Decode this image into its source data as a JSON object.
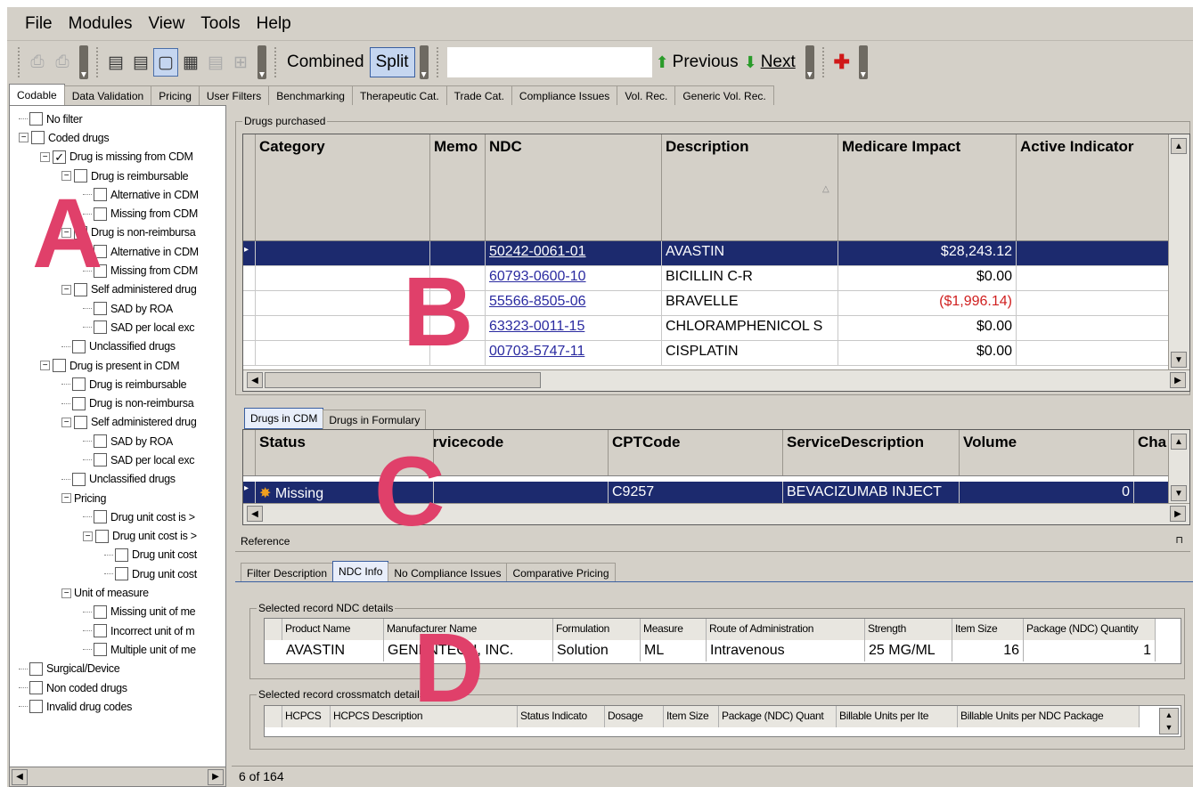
{
  "menu": {
    "file": "File",
    "modules": "Modules",
    "view": "View",
    "tools": "Tools",
    "help": "Help"
  },
  "toolbar": {
    "combined": "Combined",
    "split": "Split",
    "search_value": "",
    "previous": "Previous",
    "next": "Next"
  },
  "tabs": [
    "Codable",
    "Data Validation",
    "Pricing",
    "User Filters",
    "Benchmarking",
    "Therapeutic Cat.",
    "Trade Cat.",
    "Compliance Issues",
    "Vol. Rec.",
    "Generic Vol. Rec."
  ],
  "tree": [
    {
      "label": "No filter",
      "indent": 0,
      "exp": "",
      "checked": false
    },
    {
      "label": "Coded drugs",
      "indent": 0,
      "exp": "-",
      "checked": false
    },
    {
      "label": "Drug is missing from CDM",
      "indent": 1,
      "exp": "-",
      "checked": true
    },
    {
      "label": "Drug is reimbursable",
      "indent": 2,
      "exp": "-",
      "checked": false
    },
    {
      "label": "Alternative in CDM",
      "indent": 3,
      "exp": "",
      "checked": false
    },
    {
      "label": "Missing from CDM",
      "indent": 3,
      "exp": "",
      "checked": false
    },
    {
      "label": "Drug is non-reimbursa",
      "indent": 2,
      "exp": "-",
      "checked": false
    },
    {
      "label": "Alternative in CDM",
      "indent": 3,
      "exp": "",
      "checked": false
    },
    {
      "label": "Missing from CDM",
      "indent": 3,
      "exp": "",
      "checked": false
    },
    {
      "label": "Self administered drug",
      "indent": 2,
      "exp": "-",
      "checked": false
    },
    {
      "label": "SAD by ROA",
      "indent": 3,
      "exp": "",
      "checked": false
    },
    {
      "label": "SAD per local exc",
      "indent": 3,
      "exp": "",
      "checked": false
    },
    {
      "label": "Unclassified drugs",
      "indent": 2,
      "exp": "",
      "checked": false
    },
    {
      "label": "Drug is present in CDM",
      "indent": 1,
      "exp": "-",
      "checked": false
    },
    {
      "label": "Drug is reimbursable",
      "indent": 2,
      "exp": "",
      "checked": false
    },
    {
      "label": "Drug is non-reimbursa",
      "indent": 2,
      "exp": "",
      "checked": false
    },
    {
      "label": "Self administered drug",
      "indent": 2,
      "exp": "-",
      "checked": false
    },
    {
      "label": "SAD by ROA",
      "indent": 3,
      "exp": "",
      "checked": false
    },
    {
      "label": "SAD per local exc",
      "indent": 3,
      "exp": "",
      "checked": false
    },
    {
      "label": "Unclassified drugs",
      "indent": 2,
      "exp": "",
      "checked": false
    },
    {
      "label": "Pricing",
      "indent": 2,
      "exp": "-",
      "checked": null
    },
    {
      "label": "Drug unit cost is >",
      "indent": 3,
      "exp": "",
      "checked": false
    },
    {
      "label": "Drug unit cost is >",
      "indent": 3,
      "exp": "-",
      "checked": false
    },
    {
      "label": "Drug unit cost",
      "indent": 4,
      "exp": "",
      "checked": false
    },
    {
      "label": "Drug unit cost",
      "indent": 4,
      "exp": "",
      "checked": false
    },
    {
      "label": "Unit of measure",
      "indent": 2,
      "exp": "-",
      "checked": null
    },
    {
      "label": "Missing unit of me",
      "indent": 3,
      "exp": "",
      "checked": false
    },
    {
      "label": "Incorrect unit of m",
      "indent": 3,
      "exp": "",
      "checked": false
    },
    {
      "label": "Multiple unit of me",
      "indent": 3,
      "exp": "",
      "checked": false
    },
    {
      "label": "Surgical/Device",
      "indent": 0,
      "exp": "",
      "checked": false
    },
    {
      "label": "Non coded drugs",
      "indent": 0,
      "exp": "",
      "checked": false
    },
    {
      "label": "Invalid drug codes",
      "indent": 0,
      "exp": "",
      "checked": false
    }
  ],
  "drugs_purchased": {
    "label": "Drugs purchased",
    "columns": [
      "Category",
      "Memo",
      "NDC",
      "Description",
      "Medicare Impact",
      "Active Indicator"
    ],
    "rows": [
      {
        "ndc": "50242-0061-01",
        "description": "AVASTIN",
        "impact": "$28,243.12",
        "negative": false
      },
      {
        "ndc": "60793-0600-10",
        "description": "BICILLIN C-R",
        "impact": "$0.00",
        "negative": false
      },
      {
        "ndc": "55566-8505-06",
        "description": "BRAVELLE",
        "impact": "($1,996.14)",
        "negative": true
      },
      {
        "ndc": "63323-0011-15",
        "description": "CHLORAMPHENICOL S",
        "impact": "$0.00",
        "negative": false
      },
      {
        "ndc": "00703-5747-11",
        "description": "CISPLATIN",
        "impact": "$0.00",
        "negative": false
      }
    ]
  },
  "cdm_tabs": [
    "Drugs in CDM",
    "Drugs in Formulary"
  ],
  "cdm_grid": {
    "columns": [
      "Status",
      "Servicecode",
      "CPTCode",
      "ServiceDescription",
      "Volume",
      "Cha"
    ],
    "row": {
      "status": "Missing",
      "servicecode": "",
      "cpt": "C9257",
      "desc": "BEVACIZUMAB INJECT",
      "volume": "0"
    }
  },
  "reference": {
    "title": "Reference",
    "tabs": [
      "Filter Description",
      "NDC Info",
      "No Compliance Issues",
      "Comparative Pricing"
    ],
    "ndc_label": "Selected record NDC details",
    "ndc_columns": [
      "Product Name",
      "Manufacturer Name",
      "Formulation",
      "Measure",
      "Route of Administration",
      "Strength",
      "Item Size",
      "Package (NDC) Quantity"
    ],
    "ndc_row": [
      "AVASTIN",
      "GENENTECH, INC.",
      "Solution",
      "ML",
      "Intravenous",
      "25 MG/ML",
      "16",
      "1"
    ],
    "cross_label": "Selected record crossmatch details",
    "cross_columns": [
      "HCPCS",
      "HCPCS Description",
      "Status Indicato",
      "Dosage",
      "Item Size",
      "Package (NDC) Quant",
      "Billable Units per Ite",
      "Billable Units per NDC Package"
    ]
  },
  "status": "6 of 164",
  "annotations": [
    "A",
    "B",
    "C",
    "D"
  ]
}
